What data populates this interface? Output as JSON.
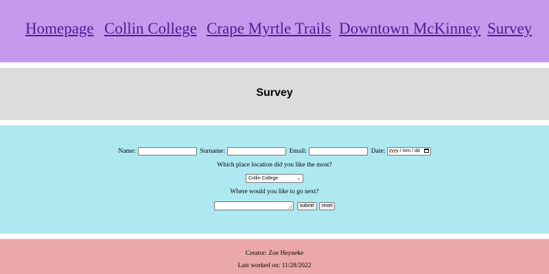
{
  "nav": {
    "links": [
      "Homepage",
      "Collin College",
      "Crape Myrtle Trails",
      "Downtown McKinney",
      "Survey"
    ]
  },
  "page": {
    "title": "Survey"
  },
  "form": {
    "name_label": "Name:",
    "name_value": "",
    "surname_label": "Surname:",
    "surname_value": "",
    "email_label": "Email:",
    "email_value": "",
    "date_label": "Date:",
    "date_placeholder": "yyyy / mm / dd",
    "question_place": "Which place location did you like the most?",
    "place_selected": "Collin College",
    "question_next": "Where would you like to go next?",
    "next_value": "",
    "submit_label": "submit",
    "reset_label": "reset"
  },
  "footer": {
    "creator": "Creator: Zoe Heyneke",
    "last_worked": "Last worked on: 11/28/2022"
  },
  "colors": {
    "nav_bg": "#c499ee",
    "title_bg": "#dcdcdc",
    "form_bg": "#aee8f0",
    "footer_bg": "#eba8a8",
    "link": "#551a8b"
  }
}
